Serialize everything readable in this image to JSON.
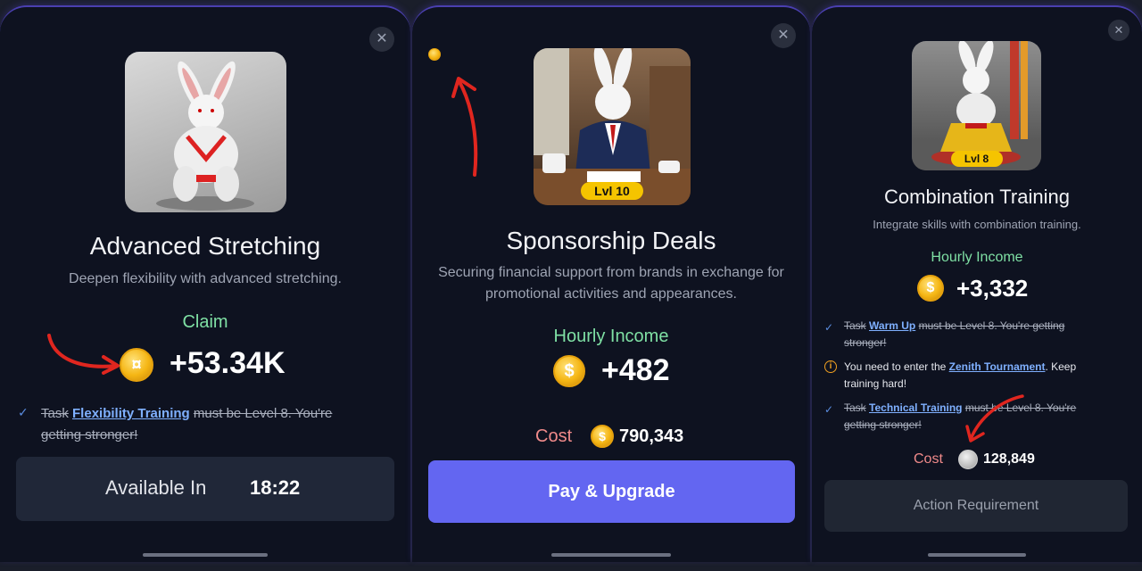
{
  "panels": {
    "left": {
      "title": "Advanced Stretching",
      "description": "Deepen flexibility with advanced stretching.",
      "income_label": "Claim",
      "income_value": "+53.34K",
      "task": {
        "prefix": "Task",
        "link": "Flexibility Training",
        "suffix": "must be Level 8. You're getting stronger!"
      },
      "button_label": "Available In",
      "button_timer": "18:22",
      "close_icon": "close-icon"
    },
    "middle": {
      "level_badge": "Lvl 10",
      "title": "Sponsorship Deals",
      "description": "Securing financial support from brands in exchange for promotional activities and appearances.",
      "income_label": "Hourly Income",
      "income_value": "+482",
      "cost_label": "Cost",
      "cost_value": "790,343",
      "button_label": "Pay & Upgrade",
      "close_icon": "close-icon"
    },
    "right": {
      "level_badge": "Lvl 8",
      "title": "Combination Training",
      "description": "Integrate skills with combination training.",
      "income_label": "Hourly Income",
      "income_value": "+3,332",
      "tasks": [
        {
          "prefix": "Task",
          "link": "Warm Up",
          "suffix": "must be Level 8. You're getting stronger!",
          "done": true
        },
        {
          "prefix": "You need to enter the",
          "link": "Zenith Tournament",
          "suffix": ". Keep training hard!",
          "done": false
        },
        {
          "prefix": "Task",
          "link": "Technical Training",
          "suffix": "must be Level 8. You're getting stronger!",
          "done": true
        }
      ],
      "cost_label": "Cost",
      "cost_value": "128,849",
      "button_label": "Action Requirement",
      "close_icon": "close-icon"
    }
  },
  "colors": {
    "accent": "#6366f1",
    "green": "#7fe0a4",
    "link": "#7fb0ff",
    "cost_red": "#f08a8a",
    "coin": "#f5b614"
  }
}
